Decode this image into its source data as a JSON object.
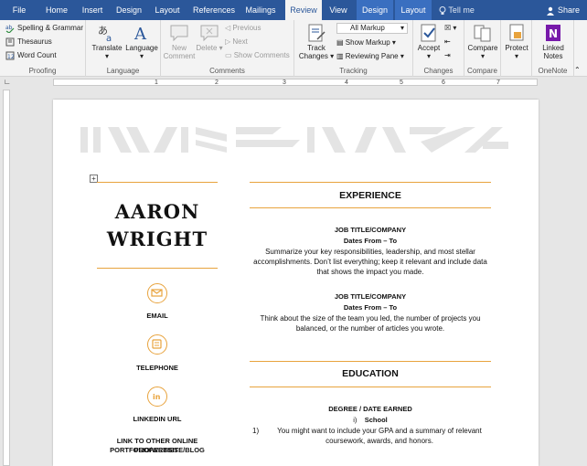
{
  "tabs": [
    {
      "label": "File"
    },
    {
      "label": "Home"
    },
    {
      "label": "Insert"
    },
    {
      "label": "Design"
    },
    {
      "label": "Layout"
    },
    {
      "label": "References"
    },
    {
      "label": "Mailings"
    },
    {
      "label": "Review"
    },
    {
      "label": "View"
    },
    {
      "label": "Design"
    },
    {
      "label": "Layout"
    }
  ],
  "tell_me": "Tell me",
  "share": "Share",
  "ribbon": {
    "proofing": {
      "spelling": "Spelling & Grammar",
      "thesaurus": "Thesaurus",
      "word_count": "Word Count",
      "label": "Proofing"
    },
    "language": {
      "translate": "Translate",
      "language": "Language",
      "label": "Language"
    },
    "comments": {
      "new_comment_1": "New",
      "new_comment_2": "Comment",
      "delete": "Delete",
      "previous": "Previous",
      "next": "Next",
      "show_comments": "Show Comments",
      "label": "Comments"
    },
    "tracking": {
      "track_1": "Track",
      "track_2": "Changes",
      "markup_select": "All Markup",
      "show_markup": "Show Markup",
      "reviewing_pane": "Reviewing Pane",
      "label": "Tracking"
    },
    "changes": {
      "accept": "Accept",
      "label": "Changes"
    },
    "compare": {
      "compare": "Compare",
      "label": "Compare"
    },
    "protect": {
      "protect": "Protect"
    },
    "onenote": {
      "linked_1": "Linked",
      "linked_2": "Notes",
      "label": "OneNote"
    }
  },
  "ruler": {
    "marks": [
      "1",
      "2",
      "3",
      "4",
      "5",
      "6",
      "7"
    ]
  },
  "resume": {
    "first_name": "AARON",
    "last_name": "WRIGHT",
    "email_label": "EMAIL",
    "telephone_label": "TELEPHONE",
    "linkedin_label": "LINKEDIN URL",
    "links_line1": "LINK TO OTHER ONLINE PROPERTIES:",
    "links_line2": "PORTFOLIO/WEBSITE/BLOG",
    "experience_title": "EXPERIENCE",
    "job1_title": "JOB TITLE/COMPANY",
    "job1_dates": "Dates From – To",
    "job1_desc": "Summarize your key responsibilities, leadership, and most stellar accomplishments. Don’t list everything; keep it relevant and include data that shows the impact you made.",
    "job2_title": "JOB TITLE/COMPANY",
    "job2_dates": "Dates From – To",
    "job2_desc": "Think about the size of the team you led, the number of projects you balanced, or the number of articles you wrote.",
    "education_title": "EDUCATION",
    "degree": "DEGREE / DATE EARNED",
    "school_marker": "i)",
    "school": "School",
    "edu_marker": "1)",
    "edu_desc": "You might want to include your GPA and a summary of relevant coursework, awards, and honors."
  },
  "colors": {
    "accent": "#e8a33d",
    "titlebar": "#2b579a",
    "ribbon": "#f3f3f3"
  }
}
